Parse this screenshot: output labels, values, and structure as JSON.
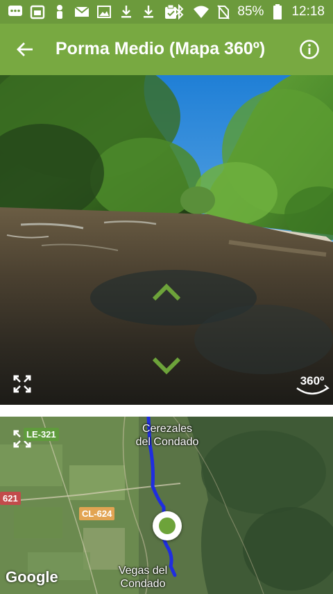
{
  "status_bar": {
    "battery_percent": "85%",
    "time": "12:18",
    "icons": [
      "chat-icon",
      "calendar-icon",
      "figure-icon",
      "mail-icon",
      "image-icon",
      "download-icon",
      "download-icon",
      "clipboard-icon",
      "bluetooth-icon",
      "wifi-icon",
      "no-sim-icon",
      "battery-icon"
    ]
  },
  "app_bar": {
    "title": "Porma Medio (Mapa 360º)",
    "back_icon": "arrow-back-icon",
    "info_icon": "info-icon"
  },
  "panorama": {
    "badge_label": "360º",
    "controls": [
      "chevron-up-icon",
      "chevron-down-icon",
      "fullscreen-icon",
      "360-view-icon"
    ]
  },
  "map": {
    "road_labels": {
      "le321": "LE-321",
      "r621": "621",
      "cl624": "CL-624"
    },
    "towns": {
      "cerezales_line1": "Cerezales",
      "cerezales_line2": "del Condado",
      "vegas_line1": "Vegas del",
      "vegas_line2": "Condado"
    },
    "attribution": "Google"
  },
  "colors": {
    "status_bar": "#6c9a3c",
    "app_bar": "#78a941",
    "accent": "#6da33a",
    "route": "#1f2de0"
  }
}
